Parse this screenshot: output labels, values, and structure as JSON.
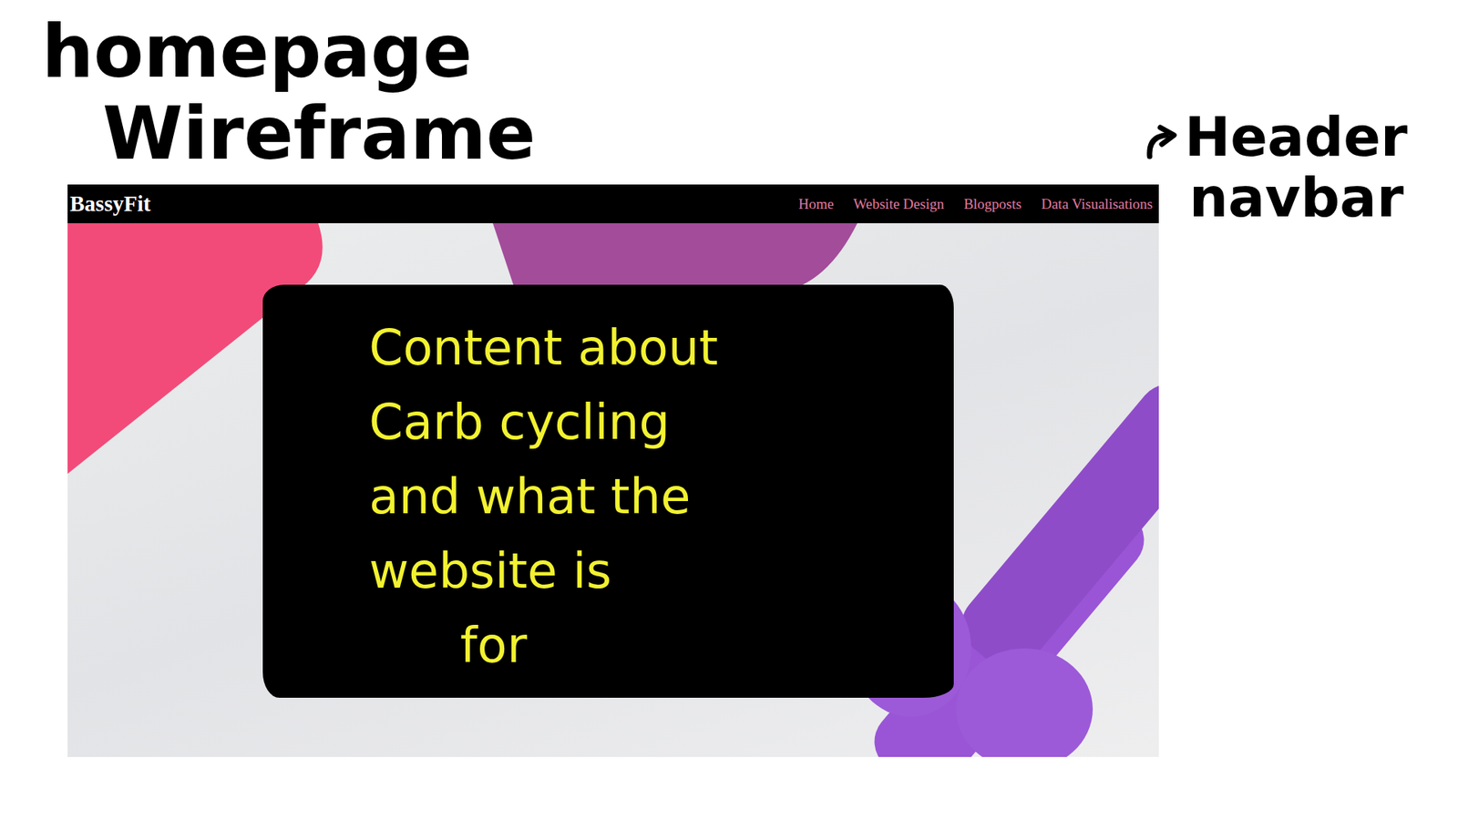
{
  "slide": {
    "title_lines": [
      "homepage",
      "Wireframe"
    ],
    "annotation_lines": [
      "Header",
      "navbar"
    ]
  },
  "mockup": {
    "brand": "BassyFit",
    "nav": [
      "Home",
      "Website Design",
      "Blogposts",
      "Data Visualisations"
    ],
    "callout_lines": [
      "Content about",
      "Carb cycling",
      "and what the",
      "website is",
      "for"
    ]
  }
}
